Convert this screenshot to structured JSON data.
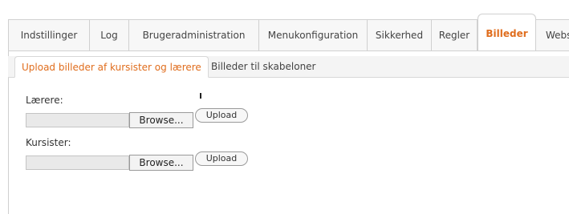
{
  "tabs": [
    {
      "label": "Indstillinger",
      "active": false
    },
    {
      "label": "Log",
      "active": false
    },
    {
      "label": "Brugeradministration",
      "active": false
    },
    {
      "label": "Menukonfiguration",
      "active": false
    },
    {
      "label": "Sikkerhed",
      "active": false
    },
    {
      "label": "Regler",
      "active": false
    },
    {
      "label": "Billeder",
      "active": true
    },
    {
      "label": "Webs",
      "active": false
    }
  ],
  "subtabs": [
    {
      "label": "Upload billeder af kursister og lærere",
      "active": true
    },
    {
      "label": "Billeder til skabeloner",
      "active": false
    }
  ],
  "form": {
    "teachers_label": "Lærere:",
    "students_label": "Kursister:",
    "browse_label": "Browse...",
    "upload_label": "Upload"
  },
  "colors": {
    "accent": "#e06d1d",
    "border": "#d0d0d0"
  }
}
